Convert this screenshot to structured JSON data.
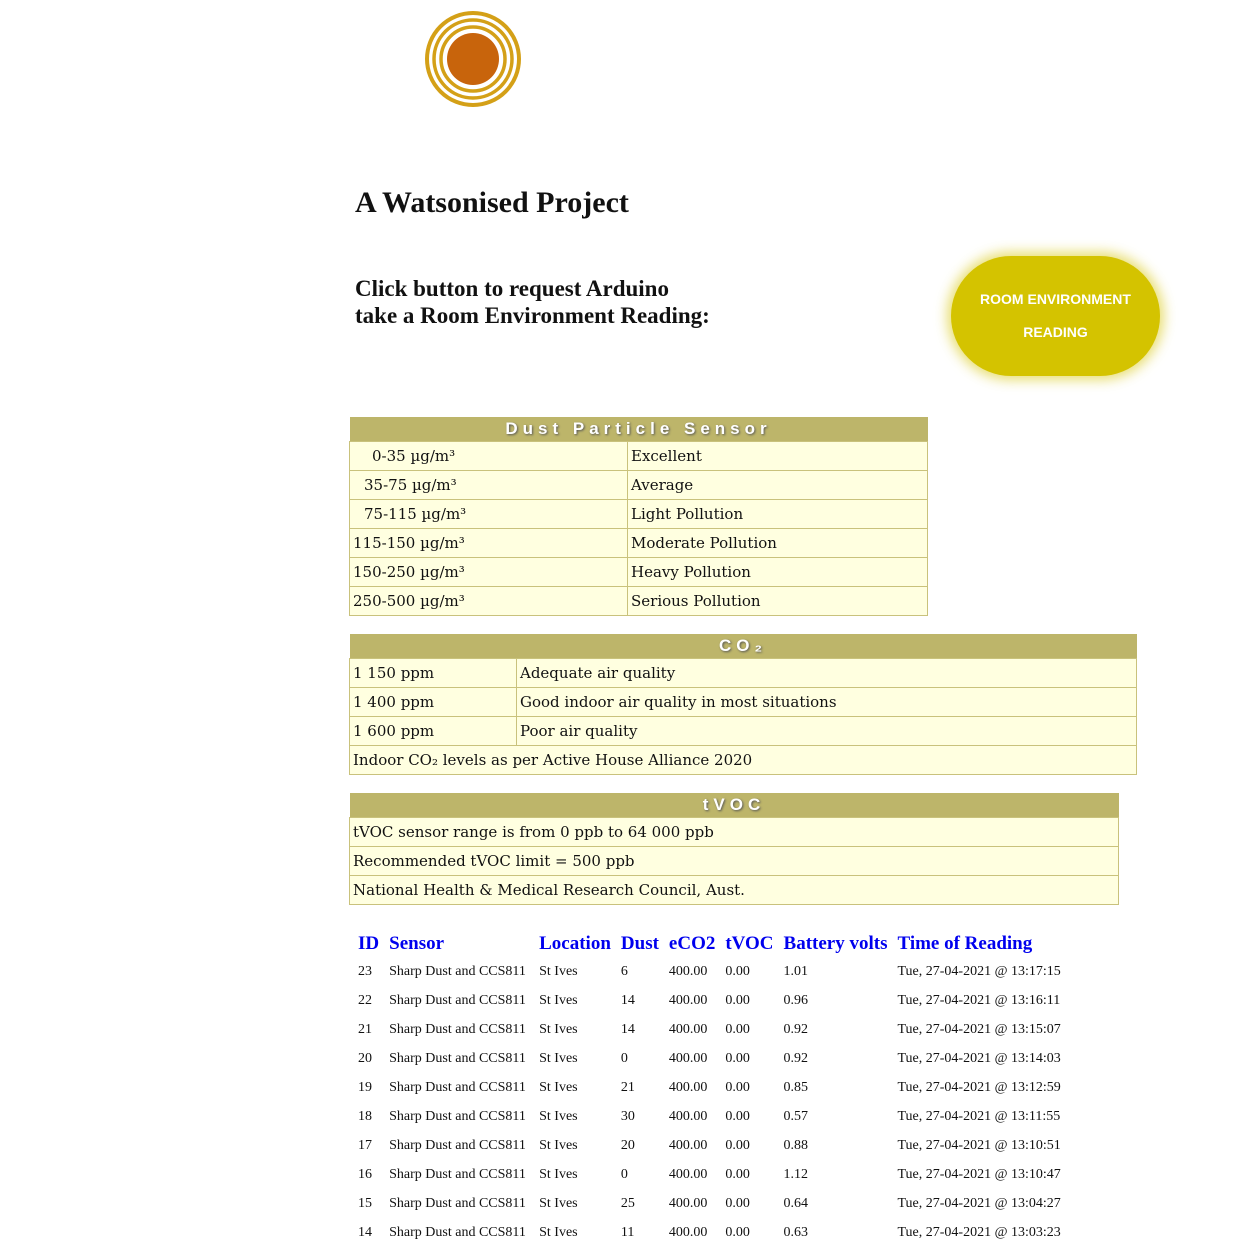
{
  "logo": {
    "name": "logo-icon",
    "color_outer": "#d4a017",
    "color_inner": "#c8640c"
  },
  "header": {
    "title": "A Watsonised Project",
    "prompt_line1": "Click button to request Arduino",
    "prompt_line2": "take a Room Environment Reading:"
  },
  "button": {
    "line1": "ROOM ENVIRONMENT",
    "line2": "READING",
    "color": "#d4c300"
  },
  "dust": {
    "title": "Dust Particle Sensor",
    "rows": [
      {
        "range": "0-35 µg/m³",
        "label": "Excellent"
      },
      {
        "range": "35-75 µg/m³",
        "label": "Average"
      },
      {
        "range": "75-115 µg/m³",
        "label": "Light Pollution"
      },
      {
        "range": "115-150 µg/m³",
        "label": "Moderate Pollution"
      },
      {
        "range": "150-250 µg/m³",
        "label": "Heavy Pollution"
      },
      {
        "range": "250-500 µg/m³",
        "label": "Serious Pollution"
      }
    ]
  },
  "co2": {
    "title": "CO₂",
    "rows": [
      {
        "level": "1 150 ppm",
        "label": "Adequate air quality"
      },
      {
        "level": "1 400 ppm",
        "label": "Good indoor air quality in most situations"
      },
      {
        "level": "1 600 ppm",
        "label": "Poor air quality"
      }
    ],
    "note": "Indoor CO₂ levels as per Active House Alliance 2020"
  },
  "tvoc": {
    "title": "tVOC",
    "rows": [
      "tVOC sensor range is from 0 ppb to 64 000 ppb",
      "Recommended tVOC limit = 500 ppb",
      "National Health & Medical Research Council, Aust."
    ]
  },
  "readings": {
    "headers": [
      "ID",
      "Sensor",
      "Location",
      "Dust",
      "eCO2",
      "tVOC",
      "Battery volts",
      "Time of Reading"
    ],
    "rows": [
      [
        "23",
        "Sharp Dust and CCS811",
        "St Ives",
        "6",
        "400.00",
        "0.00",
        "1.01",
        "Tue, 27-04-2021 @ 13:17:15"
      ],
      [
        "22",
        "Sharp Dust and CCS811",
        "St Ives",
        "14",
        "400.00",
        "0.00",
        "0.96",
        "Tue, 27-04-2021 @ 13:16:11"
      ],
      [
        "21",
        "Sharp Dust and CCS811",
        "St Ives",
        "14",
        "400.00",
        "0.00",
        "0.92",
        "Tue, 27-04-2021 @ 13:15:07"
      ],
      [
        "20",
        "Sharp Dust and CCS811",
        "St Ives",
        "0",
        "400.00",
        "0.00",
        "0.92",
        "Tue, 27-04-2021 @ 13:14:03"
      ],
      [
        "19",
        "Sharp Dust and CCS811",
        "St Ives",
        "21",
        "400.00",
        "0.00",
        "0.85",
        "Tue, 27-04-2021 @ 13:12:59"
      ],
      [
        "18",
        "Sharp Dust and CCS811",
        "St Ives",
        "30",
        "400.00",
        "0.00",
        "0.57",
        "Tue, 27-04-2021 @ 13:11:55"
      ],
      [
        "17",
        "Sharp Dust and CCS811",
        "St Ives",
        "20",
        "400.00",
        "0.00",
        "0.88",
        "Tue, 27-04-2021 @ 13:10:51"
      ],
      [
        "16",
        "Sharp Dust and CCS811",
        "St Ives",
        "0",
        "400.00",
        "0.00",
        "1.12",
        "Tue, 27-04-2021 @ 13:10:47"
      ],
      [
        "15",
        "Sharp Dust and CCS811",
        "St Ives",
        "25",
        "400.00",
        "0.00",
        "0.64",
        "Tue, 27-04-2021 @ 13:04:27"
      ],
      [
        "14",
        "Sharp Dust and CCS811",
        "St Ives",
        "11",
        "400.00",
        "0.00",
        "0.63",
        "Tue, 27-04-2021 @ 13:03:23"
      ]
    ]
  }
}
